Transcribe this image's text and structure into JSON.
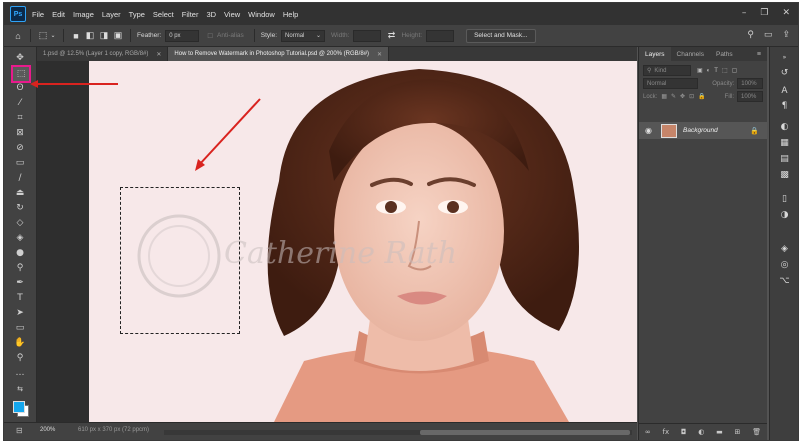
{
  "app": {
    "logo": "Ps"
  },
  "menu": [
    "File",
    "Edit",
    "Image",
    "Layer",
    "Type",
    "Select",
    "Filter",
    "3D",
    "View",
    "Window",
    "Help"
  ],
  "options": {
    "feather_label": "Feather:",
    "feather_value": "0 px",
    "antialias_label": "Anti-alias",
    "style_label": "Style:",
    "style_value": "Normal",
    "width_label": "Width:",
    "height_label": "Height:",
    "select_mask_label": "Select and Mask..."
  },
  "tabs": [
    {
      "label": "1.psd @ 12.5% (Layer 1 copy, RGB/8#)",
      "active": false
    },
    {
      "label": "How to Remove Watermark in Photoshop Tutorial.psd @ 200% (RGB/8#)",
      "active": true
    }
  ],
  "canvas": {
    "watermark_text": "Catherine Rath"
  },
  "status": {
    "zoom": "200%",
    "doc_info": "610 px x 370 px (72 ppcm)"
  },
  "panel": {
    "tabs": [
      "Layers",
      "Channels",
      "Paths"
    ],
    "filter_label": "Kind",
    "blend_mode": "Normal",
    "opacity_label": "Opacity:",
    "opacity_value": "100%",
    "lock_label": "Lock:",
    "fill_label": "Fill:",
    "fill_value": "100%",
    "layer_name": "Background"
  },
  "colors": {
    "foreground": "#14a7ee",
    "background": "#ffffff",
    "highlight": "#e81a8c",
    "arrow": "#d9231f"
  },
  "icons": {
    "tools": [
      "move-icon",
      "marquee-icon",
      "lasso-icon",
      "magic-wand-icon",
      "crop-icon",
      "frame-icon",
      "eyedropper-icon",
      "healing-brush-icon",
      "brush-icon",
      "clone-stamp-icon",
      "history-brush-icon",
      "eraser-icon",
      "gradient-icon",
      "blur-icon",
      "dodge-icon",
      "pen-icon",
      "type-icon",
      "path-selection-icon",
      "rectangle-icon",
      "hand-icon",
      "zoom-icon",
      "more-tools-icon"
    ]
  }
}
